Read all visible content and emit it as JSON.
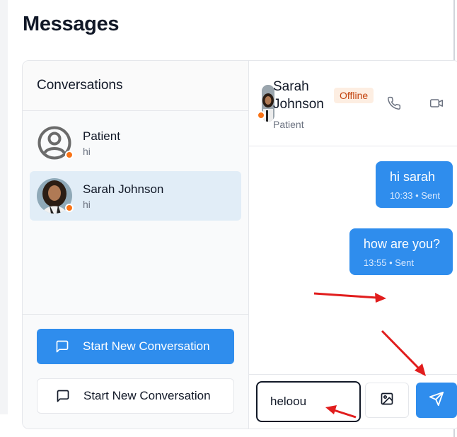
{
  "page": {
    "title": "Messages"
  },
  "sidebar": {
    "header": "Conversations",
    "conversations": [
      {
        "name": "Patient",
        "preview": "hi",
        "avatar": "default-user-icon",
        "status": "away",
        "active": false
      },
      {
        "name": "Sarah Johnson",
        "preview": "hi",
        "avatar": "photo",
        "status": "away",
        "active": true
      }
    ],
    "buttons": {
      "primary_label": "Start New Conversation",
      "secondary_label": "Start New Conversation",
      "icon": "message-square-icon"
    }
  },
  "chat": {
    "contact_name": "Sarah Johnson",
    "contact_role": "Patient",
    "status_badge": "Offline",
    "actions": [
      "phone-icon",
      "video-icon"
    ],
    "messages": [
      {
        "text": "hi sarah",
        "meta": "10:33 • Sent",
        "outgoing": true
      },
      {
        "text": "how are you?",
        "meta": "13:55 • Sent",
        "outgoing": true
      }
    ],
    "composer": {
      "value": "heloou",
      "attach_icon": "image-icon",
      "send_icon": "send-icon"
    }
  },
  "colors": {
    "accent": "#2f8ded",
    "status_dot": "#f97316",
    "offline_badge_bg": "#fdeee2",
    "offline_badge_text": "#c2410c",
    "annotation_arrow": "#e11d1d"
  },
  "annotations": [
    "red-arrow",
    "red-arrow",
    "red-arrow"
  ]
}
